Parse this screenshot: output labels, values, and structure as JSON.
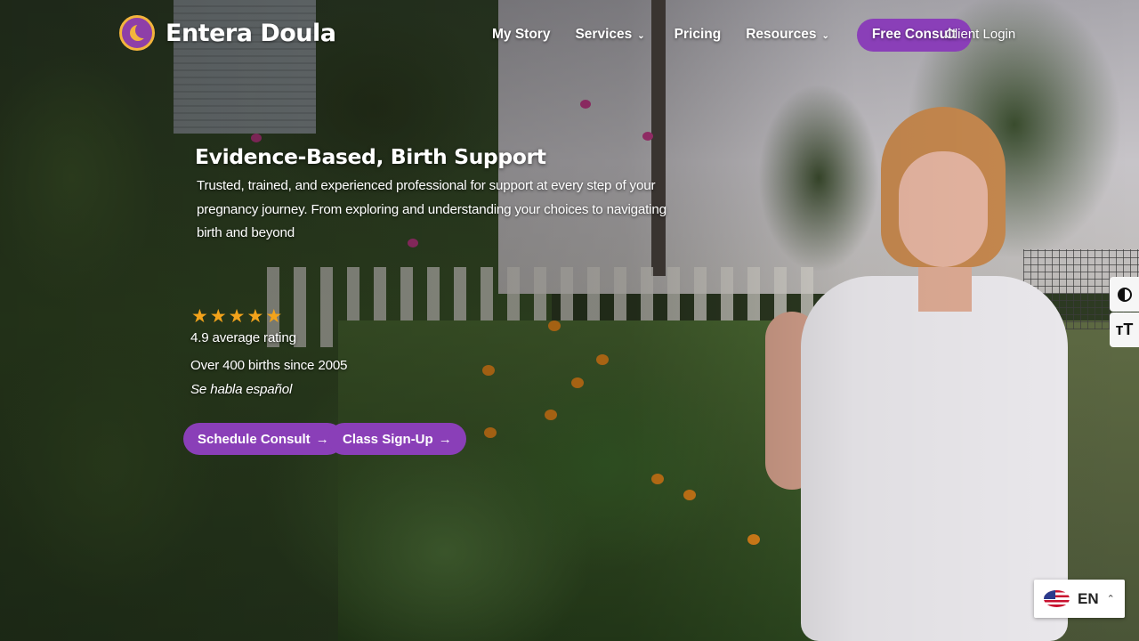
{
  "brand": {
    "name": "Entera Doula"
  },
  "nav": {
    "my_story": "My Story",
    "services": "Services",
    "pricing": "Pricing",
    "resources": "Resources",
    "free_consult": "Free Consult",
    "client_login": "Client Login"
  },
  "hero": {
    "title": "Evidence-Based, Birth Support",
    "description": "Trusted, trained, and experienced professional for support at every step of your pregnancy journey. From exploring and understanding your choices to navigating birth and beyond",
    "rating_stars": 5,
    "rating_text": "4.9 average rating",
    "births_text": "Over 400 births since 2005",
    "spanish_text": "Se habla español",
    "cta_schedule": "Schedule Consult",
    "cta_class": "Class Sign-Up"
  },
  "accessibility": {
    "contrast_icon": "contrast-icon",
    "text_size_label": "ᴛT"
  },
  "language": {
    "code": "EN",
    "flag_icon": "us-flag-icon"
  },
  "colors": {
    "accent_purple": "#8a3fb8",
    "star_orange": "#f2a31b",
    "logo_gold": "#f3b43c"
  }
}
